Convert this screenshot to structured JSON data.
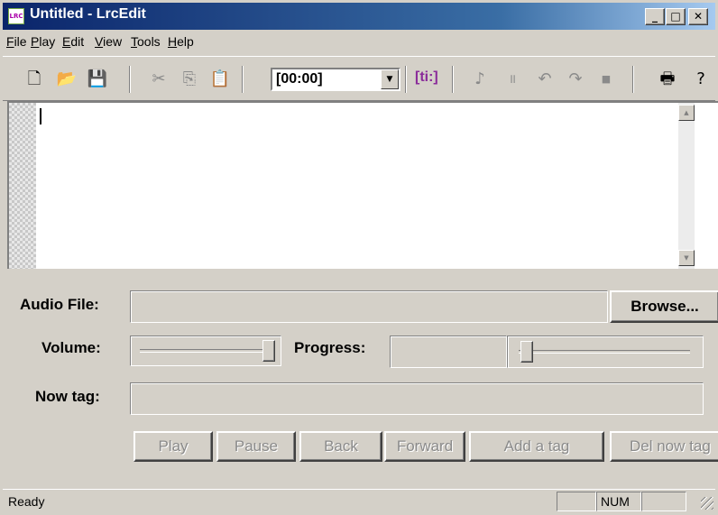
{
  "window": {
    "title": "Untitled - LrcEdit",
    "icon_label": "LRC",
    "controls": {
      "minimize": "_",
      "maximize": "□",
      "close": "✕"
    }
  },
  "menu": [
    {
      "label": "File",
      "mnemonic": "F",
      "rest": "ile"
    },
    {
      "label": "Play",
      "mnemonic": "P",
      "rest": "lay"
    },
    {
      "label": "Edit",
      "mnemonic": "E",
      "rest": "dit"
    },
    {
      "label": "View",
      "mnemonic": "V",
      "rest": "iew"
    },
    {
      "label": "Tools",
      "mnemonic": "T",
      "rest": "ools"
    },
    {
      "label": "Help",
      "mnemonic": "H",
      "rest": "elp"
    }
  ],
  "toolbar": {
    "new_glyph": "🗋",
    "open_glyph": "📂",
    "save_glyph": "💾",
    "cut_glyph": "✂",
    "copy_glyph": "⎘",
    "paste_glyph": "📋",
    "time_combo_value": "[00:00]",
    "combo_arrow": "▼",
    "ti_tag": "[ti:]",
    "play_glyph": "♪",
    "pause_glyph": "॥",
    "back_glyph": "↶",
    "forward_glyph": "↷",
    "stop_glyph": "■",
    "print_glyph": "🖶",
    "help_glyph": "?"
  },
  "editor": {
    "scroll_up": "▲",
    "scroll_down": "▼"
  },
  "panel": {
    "audio_file_label": "Audio File:",
    "audio_file_value": "",
    "browse_label": "Browse...",
    "volume_label": "Volume:",
    "volume_level": 1.0,
    "progress_label": "Progress:",
    "progress_value_text": "",
    "progress_level": 0.0,
    "now_tag_label": "Now tag:",
    "now_tag_value": "",
    "buttons": {
      "play": "Play",
      "pause": "Pause",
      "back": "Back",
      "forward": "Forward",
      "add_tag": "Add a tag",
      "del_tag": "Del now tag"
    }
  },
  "status": {
    "text": "Ready",
    "num": "NUM"
  }
}
